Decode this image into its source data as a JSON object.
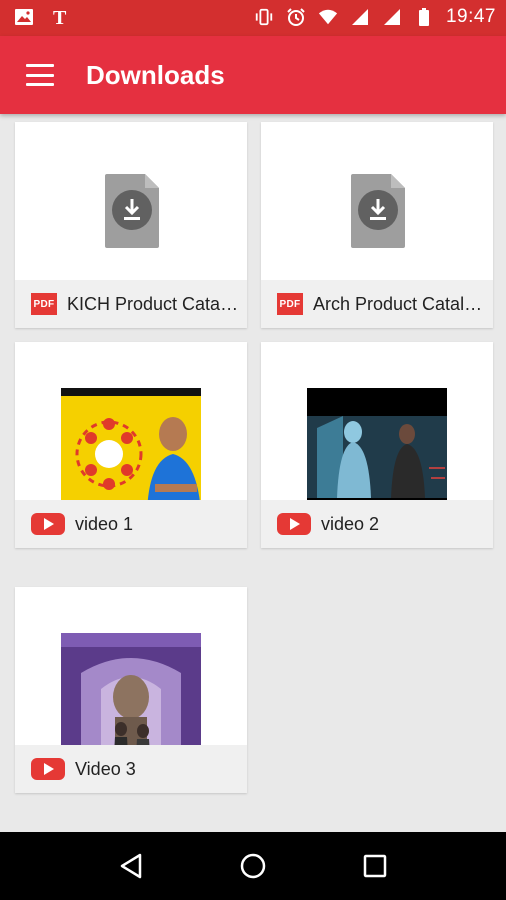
{
  "status_bar": {
    "time": "19:47",
    "icons": [
      "image-icon",
      "nyt-icon",
      "vibrate-icon",
      "alarm-icon",
      "wifi-icon",
      "signal-icon",
      "no-signal-icon",
      "battery-icon"
    ]
  },
  "app_bar": {
    "title": "Downloads",
    "menu_icon": "hamburger-menu-icon"
  },
  "items": [
    {
      "type": "pdf",
      "icon_label": "PDF",
      "label": "KICH Product Catal…"
    },
    {
      "type": "pdf",
      "icon_label": "PDF",
      "label": "Arch Product Catal…"
    },
    {
      "type": "video",
      "label": "video 1"
    },
    {
      "type": "video",
      "label": "video 2"
    },
    {
      "type": "video",
      "label": "Video 3"
    }
  ],
  "colors": {
    "status_bar": "#d32f2f",
    "app_bar": "#e53040",
    "background": "#e9e9e9",
    "pdf_red": "#e53935",
    "youtube_red": "#e53935"
  },
  "nav_bar": {
    "buttons": [
      "back-icon",
      "home-icon",
      "recents-icon"
    ]
  }
}
